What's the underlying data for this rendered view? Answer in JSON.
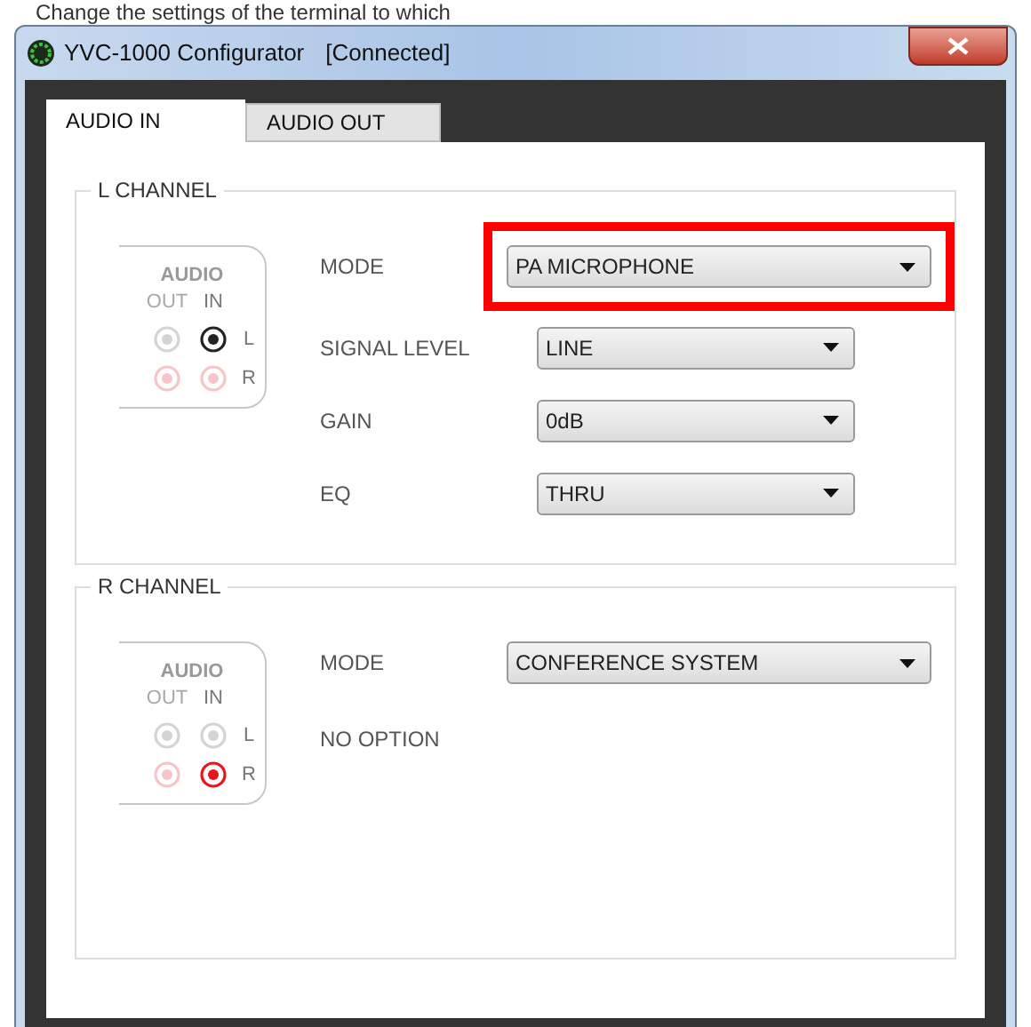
{
  "caption": "Change the settings of the terminal to which",
  "window": {
    "title": "YVC-1000 Configurator",
    "status": "[Connected]"
  },
  "tabs": [
    {
      "label": "AUDIO IN",
      "selected": true
    },
    {
      "label": "AUDIO OUT",
      "selected": false
    }
  ],
  "channels": [
    {
      "title": "L CHANNEL",
      "jack_panel": {
        "title": "AUDIO",
        "out_label": "OUT",
        "in_label": "IN",
        "rows": [
          {
            "label": "L",
            "kind": "left",
            "out_active": false,
            "in_active": true
          },
          {
            "label": "R",
            "kind": "right",
            "out_active": false,
            "in_active": false
          }
        ]
      },
      "settings": [
        {
          "kind": "mode",
          "label": "MODE",
          "value": "PA MICROPHONE",
          "highlighted": true
        },
        {
          "kind": "option",
          "label": "SIGNAL LEVEL",
          "value": "LINE",
          "highlighted": false
        },
        {
          "kind": "option",
          "label": "GAIN",
          "value": "0dB",
          "highlighted": false
        },
        {
          "kind": "option",
          "label": "EQ",
          "value": "THRU",
          "highlighted": false
        }
      ]
    },
    {
      "title": "R CHANNEL",
      "jack_panel": {
        "title": "AUDIO",
        "out_label": "OUT",
        "in_label": "IN",
        "rows": [
          {
            "label": "L",
            "kind": "left",
            "out_active": false,
            "in_active": false
          },
          {
            "label": "R",
            "kind": "right",
            "out_active": false,
            "in_active": true
          }
        ]
      },
      "settings": [
        {
          "kind": "mode",
          "label": "MODE",
          "value": "CONFERENCE SYSTEM",
          "highlighted": false
        },
        {
          "kind": "note",
          "label": "NO OPTION"
        }
      ]
    }
  ]
}
